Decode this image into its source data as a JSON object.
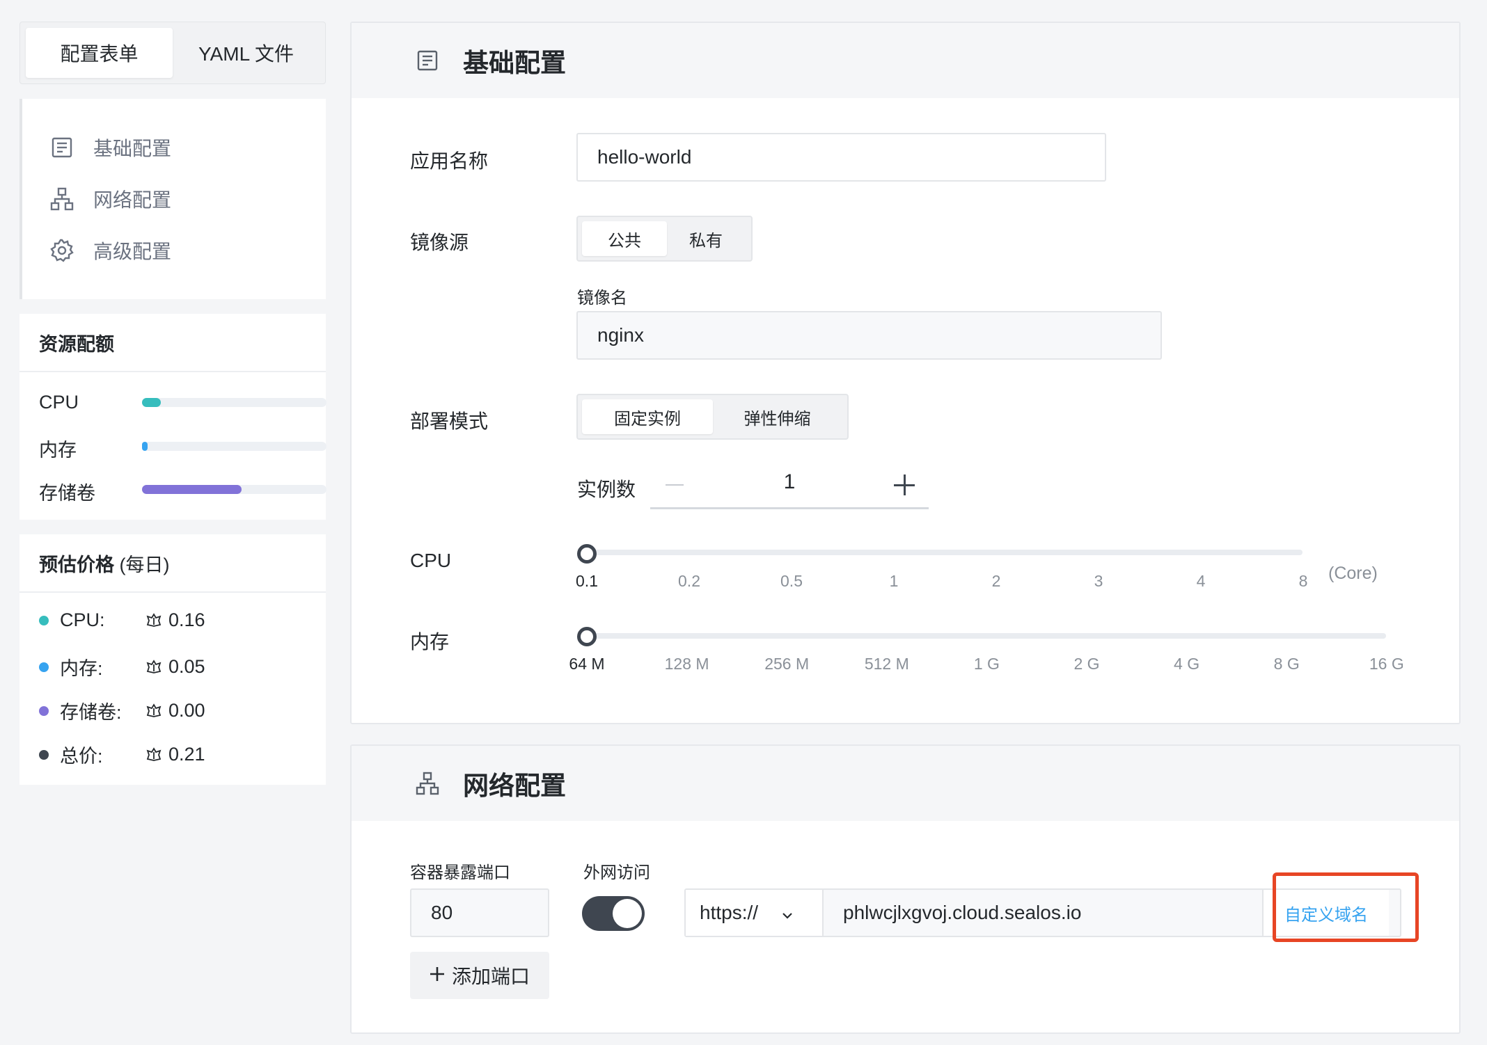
{
  "tabs": {
    "form": "配置表单",
    "yaml": "YAML 文件"
  },
  "nav": [
    {
      "label": "基础配置",
      "icon": "document-icon"
    },
    {
      "label": "网络配置",
      "icon": "network-icon"
    },
    {
      "label": "高级配置",
      "icon": "gear-icon"
    }
  ],
  "quota": {
    "title": "资源配额",
    "items": [
      {
        "label": "CPU",
        "fraction": 0.1,
        "color": "#36bdbd"
      },
      {
        "label": "内存",
        "fraction": 0.03,
        "color": "#36a3f0"
      },
      {
        "label": "存储卷",
        "fraction": 0.54,
        "color": "#8172d8"
      }
    ]
  },
  "price": {
    "title": "预估价格",
    "title_suffix": "(每日)",
    "items": [
      {
        "label": "CPU:",
        "value": "0.16",
        "color": "#36bdbd"
      },
      {
        "label": "内存:",
        "value": "0.05",
        "color": "#36a3f0"
      },
      {
        "label": "存储卷:",
        "value": "0.00",
        "color": "#8172d8"
      },
      {
        "label": "总价:",
        "value": "0.21",
        "color": "#3f4650"
      }
    ]
  },
  "basic": {
    "title": "基础配置",
    "app_name_label": "应用名称",
    "app_name_value": "hello-world",
    "image_source_label": "镜像源",
    "image_source_options": [
      "公共",
      "私有"
    ],
    "image_name_label": "镜像名",
    "image_name_value": "nginx",
    "deploy_mode_label": "部署模式",
    "deploy_mode_options": [
      "固定实例",
      "弹性伸缩"
    ],
    "instances_label": "实例数",
    "instances_value": "1",
    "cpu_label": "CPU",
    "cpu_ticks": [
      "0.1",
      "0.2",
      "0.5",
      "1",
      "2",
      "3",
      "4",
      "8"
    ],
    "cpu_unit": "(Core)",
    "cpu_selected": "0.1",
    "memory_label": "内存",
    "memory_ticks": [
      "64 M",
      "128 M",
      "256 M",
      "512 M",
      "1 G",
      "2 G",
      "4 G",
      "8 G",
      "16 G"
    ],
    "memory_selected": "64 M"
  },
  "network": {
    "title": "网络配置",
    "port_label": "容器暴露端口",
    "port_value": "80",
    "public_label": "外网访问",
    "public_enabled": true,
    "protocol": "https://",
    "domain": "phlwcjlxgvoj.cloud.sealos.io",
    "custom_domain": "自定义域名",
    "add_port": "添加端口"
  }
}
